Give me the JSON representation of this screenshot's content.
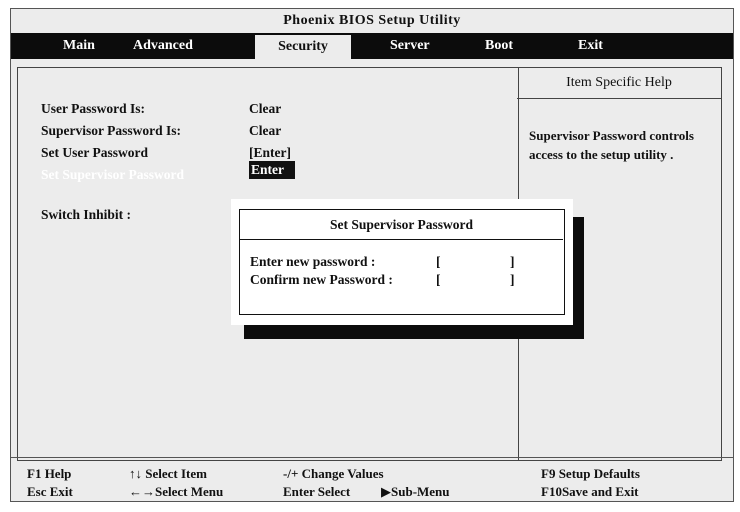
{
  "title": "Phoenix BIOS Setup Utility",
  "menu": [
    {
      "label": "Main"
    },
    {
      "label": "Advanced"
    },
    {
      "label": "Security"
    },
    {
      "label": "Server"
    },
    {
      "label": "Boot"
    },
    {
      "label": "Exit"
    }
  ],
  "fields": {
    "user_password_label": "User Password Is:",
    "user_password_value": "Clear",
    "supervisor_password_label": "Supervisor Password Is:",
    "supervisor_password_value": "Clear",
    "set_user_password_label": "Set User Password",
    "set_user_password_value": "[Enter]",
    "set_supervisor_password_label": "Set Supervisor Password",
    "set_supervisor_password_value": "Enter",
    "switch_inhibit_label": "Switch Inhibit :"
  },
  "help": {
    "title": "Item Specific Help",
    "text": "Supervisor Password controls access to the setup utility ."
  },
  "dialog": {
    "title": "Set Supervisor Password",
    "new_password_label": "Enter new password :",
    "confirm_password_label": "Confirm new Password :",
    "bracket_open": "[",
    "bracket_close": "]"
  },
  "footer": {
    "f1": "F1 Help",
    "esc": "Esc Exit",
    "updown": "↑↓ Select Item",
    "leftright": "←→Select Menu",
    "plusminus": "-/+ Change Values",
    "enter": "Enter Select",
    "submenu": "▶Sub-Menu",
    "f9": "F9 Setup Defaults",
    "f10": "F10Save and Exit"
  },
  "colors": {
    "menu_bar": "#0c0c0c",
    "screen_bg": "#ececec",
    "highlight_text": "#ffffff"
  }
}
